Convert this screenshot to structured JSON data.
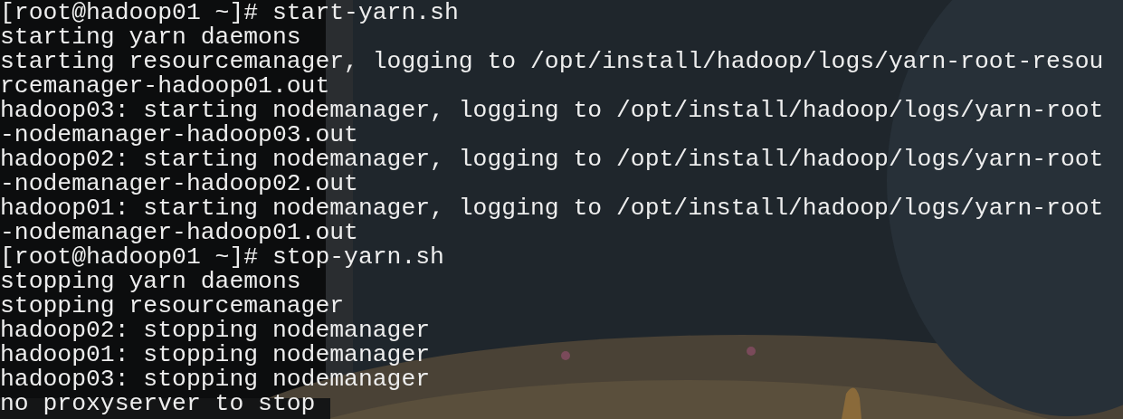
{
  "terminal": {
    "lines": [
      "[root@hadoop01 ~]# start-yarn.sh",
      "starting yarn daemons",
      "starting resourcemanager, logging to /opt/install/hadoop/logs/yarn-root-resou",
      "rcemanager-hadoop01.out",
      "hadoop03: starting nodemanager, logging to /opt/install/hadoop/logs/yarn-root",
      "-nodemanager-hadoop03.out",
      "hadoop02: starting nodemanager, logging to /opt/install/hadoop/logs/yarn-root",
      "-nodemanager-hadoop02.out",
      "hadoop01: starting nodemanager, logging to /opt/install/hadoop/logs/yarn-root",
      "-nodemanager-hadoop01.out",
      "[root@hadoop01 ~]# stop-yarn.sh",
      "stopping yarn daemons",
      "stopping resourcemanager",
      "hadoop02: stopping nodemanager",
      "hadoop01: stopping nodemanager",
      "hadoop03: stopping nodemanager",
      "no proxyserver to stop"
    ]
  }
}
